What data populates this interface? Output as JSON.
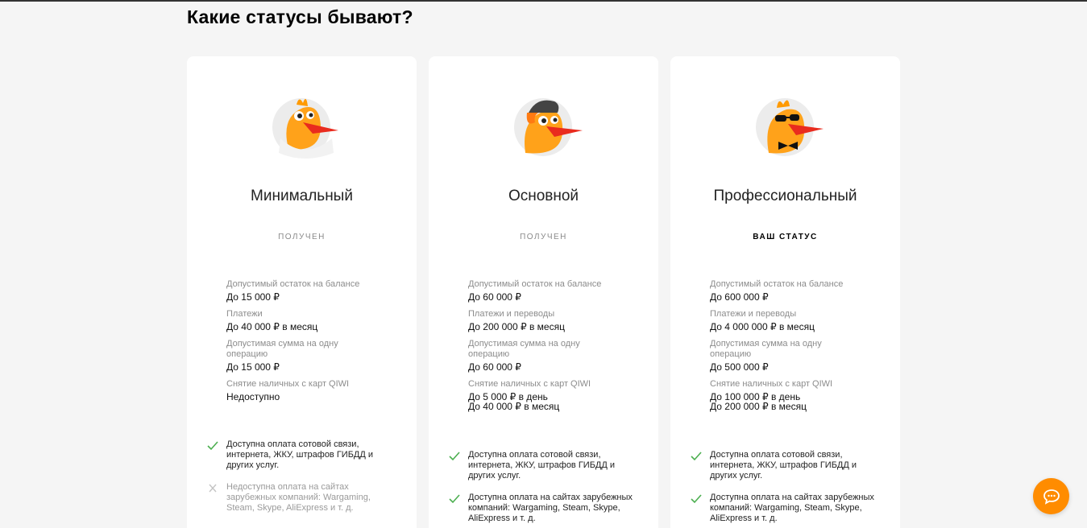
{
  "page": {
    "title": "Какие статусы бывают?"
  },
  "cards": [
    {
      "name": "Минимальный",
      "status": "ПОЛУЧЕН",
      "features": [
        {
          "label": "Допустимый остаток на балансе",
          "value": "До 15 000 ₽"
        },
        {
          "label": "Платежи",
          "value": "До 40 000 ₽ в месяц"
        },
        {
          "label": "Допустимая сумма на одну операцию",
          "value": "До 15 000 ₽"
        },
        {
          "label": "Снятие наличных с карт QIWI",
          "value": "Недоступно"
        }
      ],
      "checks": [
        {
          "text": "Доступна оплата сотовой связи, интернета, ЖКУ, штрафов ГИБДД и других услуг.",
          "enabled": true
        },
        {
          "text": "Недоступна оплата на сайтах зарубежных компаний: Wargaming, Steam, Skype, AliExpress и т. д.",
          "enabled": false
        }
      ]
    },
    {
      "name": "Основной",
      "status": "ПОЛУЧЕН",
      "features": [
        {
          "label": "Допустимый остаток на балансе",
          "value": "До 60 000 ₽"
        },
        {
          "label": "Платежи и переводы",
          "value": "До 200 000 ₽ в месяц"
        },
        {
          "label": "Допустимая сумма на одну операцию",
          "value": "До 60 000 ₽"
        },
        {
          "label": "Снятие наличных с карт QIWI",
          "value": "До 5 000 ₽ в день\nДо 40 000 ₽ в месяц"
        }
      ],
      "checks": [
        {
          "text": "Доступна оплата сотовой связи, интернета, ЖКУ, штрафов ГИБДД и других услуг.",
          "enabled": true
        },
        {
          "text": "Доступна оплата на сайтах зарубежных компаний: Wargaming, Steam, Skype, AliExpress и т. д.",
          "enabled": true
        }
      ]
    },
    {
      "name": "Профессиональный",
      "status": "ВАШ СТАТУС",
      "features": [
        {
          "label": "Допустимый остаток на балансе",
          "value": "До 600 000 ₽"
        },
        {
          "label": "Платежи и переводы",
          "value": "До 4 000 000 ₽ в месяц"
        },
        {
          "label": "Допустимая сумма на одну операцию",
          "value": "До 500 000 ₽"
        },
        {
          "label": "Снятие наличных с карт QIWI",
          "value": "До 100 000 ₽ в день\nДо 200 000 ₽ в месяц"
        }
      ],
      "checks": [
        {
          "text": "Доступна оплата сотовой связи, интернета, ЖКУ, штрафов ГИБДД и других услуг.",
          "enabled": true
        },
        {
          "text": "Доступна оплата на сайтах зарубежных компаний: Wargaming, Steam, Skype, AliExpress и т. д.",
          "enabled": true
        }
      ]
    }
  ],
  "icons": {
    "check": "checkmark-icon",
    "cross": "cross-icon",
    "chat": "chat-bubble-icon",
    "mascot": "bird-mascot-icon"
  },
  "colors": {
    "accent": "#ff8c00",
    "check_green": "#4caf50",
    "cross_grey": "#c4c4c4",
    "muted_text": "#8c8c8c"
  }
}
